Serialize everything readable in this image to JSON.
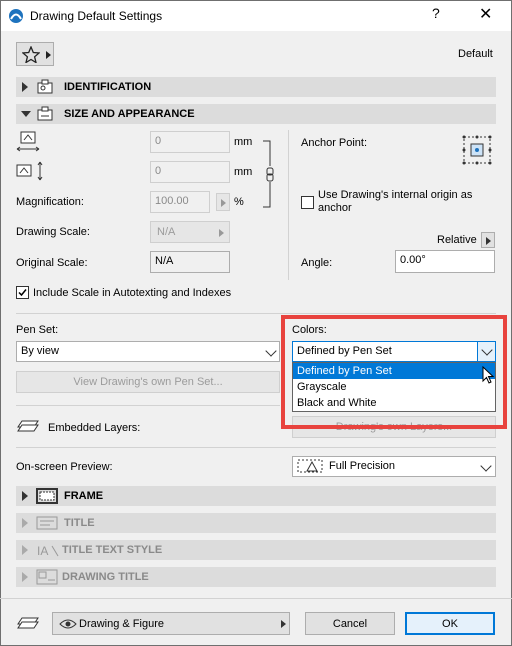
{
  "window": {
    "title": "Drawing Default Settings",
    "help": "?",
    "close": "✕"
  },
  "header": {
    "preset_label": "Default"
  },
  "sections": {
    "identification": "IDENTIFICATION",
    "size_appearance": "SIZE AND APPEARANCE",
    "frame": "FRAME",
    "title": "TITLE",
    "title_text_style": "TITLE TEXT STYLE",
    "drawing_title": "DRAWING TITLE"
  },
  "size": {
    "width_value": "0",
    "height_value": "0",
    "unit": "mm",
    "magnification_label": "Magnification:",
    "magnification_value": "100.00",
    "percent": "%",
    "drawing_scale_label": "Drawing Scale:",
    "drawing_scale_value": "N/A",
    "original_scale_label": "Original Scale:",
    "original_scale_value": "N/A",
    "anchor_label": "Anchor Point:",
    "use_origin_label": "Use Drawing's internal origin as anchor",
    "relative_label": "Relative",
    "angle_label": "Angle:",
    "angle_value": "0.00°",
    "include_scale_label": "Include Scale in Autotexting and Indexes"
  },
  "pens": {
    "pen_set_label": "Pen Set:",
    "pen_set_value": "By view",
    "colors_label": "Colors:",
    "colors_value": "Defined by Pen Set",
    "colors_options": [
      "Defined by Pen Set",
      "Grayscale",
      "Black and White"
    ],
    "view_pen_set_button": "View Drawing's own Pen Set...",
    "embedded_layers_label": "Embedded Layers:",
    "own_layers_button": "Drawing's own Layers..."
  },
  "preview": {
    "label": "On-screen Preview:",
    "value": "Full Precision"
  },
  "footer": {
    "layer_value": "Drawing & Figure",
    "cancel": "Cancel",
    "ok": "OK"
  },
  "colors": {
    "accent": "#e8433e",
    "selection": "#0078d7"
  }
}
